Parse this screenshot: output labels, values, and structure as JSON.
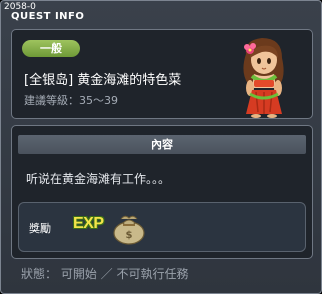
{
  "window": {
    "tag": "2058-0",
    "title": "QUEST INFO"
  },
  "quest": {
    "badge": "一般",
    "name": "[全银岛] 黄金海滩的特色菜",
    "level": "建議等級：35～39",
    "npc_icon": "hula-girl-npc-portrait"
  },
  "content": {
    "header": "內容",
    "description": "听说在黄金海滩有工作。。。"
  },
  "reward": {
    "label": "獎勵",
    "exp_text": "EXP",
    "item_icon": "money-bag-icon"
  },
  "footer": {
    "status": "狀態： 可開始 ／ 不可執行任務"
  },
  "colors": {
    "badge_green": "#8ab54a",
    "panel_bg": "#1f242b",
    "window_bg": "#353c45",
    "exp_yellow": "#f3e44a"
  }
}
